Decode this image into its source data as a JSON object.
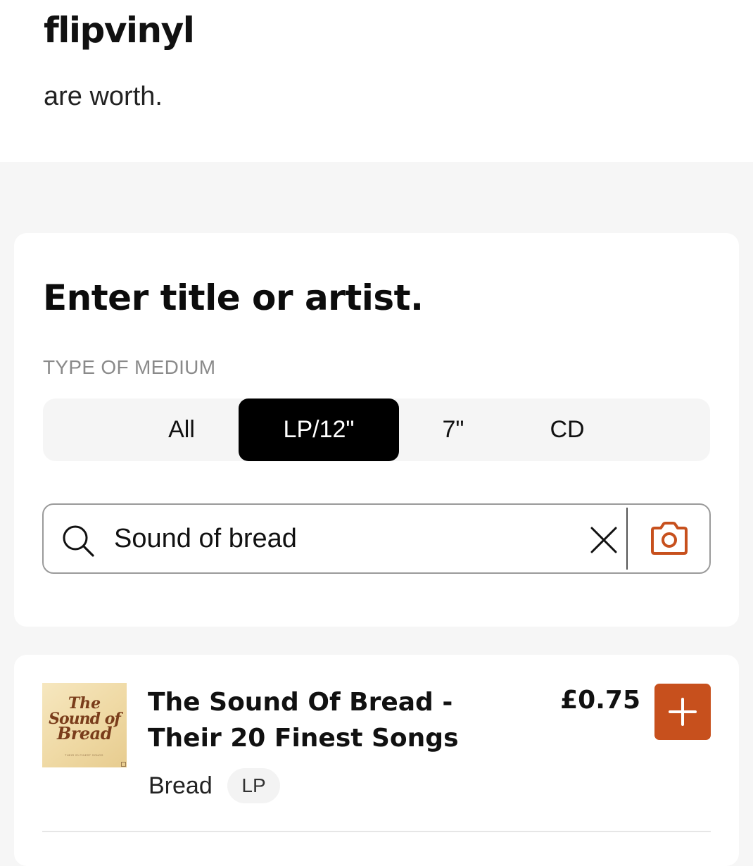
{
  "header": {
    "logo": "flipvinyl",
    "tagline": "are worth."
  },
  "search": {
    "heading": "Enter title or artist.",
    "medium_label": "TYPE OF MEDIUM",
    "mediums": [
      {
        "label": "All",
        "selected": false
      },
      {
        "label": "LP/12\"",
        "selected": true
      },
      {
        "label": "7\"",
        "selected": false
      },
      {
        "label": "CD",
        "selected": false
      }
    ],
    "query": "Sound of bread",
    "icons": [
      "search-icon",
      "clear-icon",
      "camera-icon"
    ]
  },
  "results": [
    {
      "cover_lines": [
        "The",
        "Sound of",
        "Bread"
      ],
      "cover_subtitle": "THEIR 20 FINEST SONGS",
      "title": "The Sound Of Bread - Their 20 Finest Songs",
      "price": "£0.75",
      "artist": "Bread",
      "format": "LP",
      "add_icon": "plus-icon"
    }
  ],
  "colors": {
    "accent": "#c7501d",
    "segment_active_bg": "#000000",
    "page_background": "#f6f6f6",
    "card_background": "#ffffff",
    "label_gray": "#8a8a8a"
  }
}
